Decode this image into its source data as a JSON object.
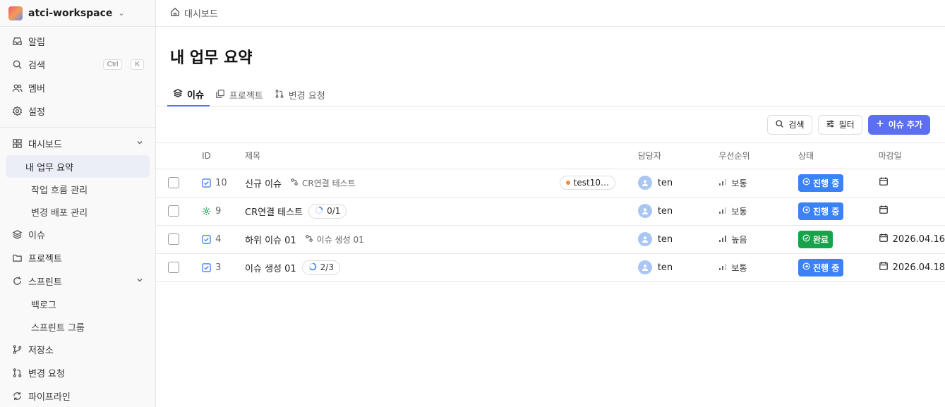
{
  "workspace": {
    "name": "atci-workspace"
  },
  "sidebar": {
    "top_items": [
      {
        "label": "알림",
        "icon": "inbox-icon"
      },
      {
        "label": "검색",
        "icon": "search-icon",
        "shortcut": [
          "Ctrl",
          "K"
        ]
      },
      {
        "label": "멤버",
        "icon": "members-icon"
      },
      {
        "label": "설정",
        "icon": "settings-icon"
      }
    ],
    "dashboard": {
      "label": "대시보드",
      "children": [
        "내 업무 요약",
        "작업 흐름 관리",
        "변경 배포 관리"
      ]
    },
    "issues": "이슈",
    "projects": "프로젝트",
    "sprint": {
      "label": "스프린트",
      "children": [
        "백로그",
        "스프린트 그룹"
      ]
    },
    "repository": "저장소",
    "change_request": "변경 요청",
    "pipeline": "파이프라인"
  },
  "breadcrumb": "대시보드",
  "page_title": "내 업무 요약",
  "tabs": [
    {
      "label": "이슈",
      "active": true
    },
    {
      "label": "프로젝트",
      "active": false
    },
    {
      "label": "변경 요청",
      "active": false
    }
  ],
  "toolbar": {
    "search": "검색",
    "filter": "필터",
    "add_issue": "이슈 추가"
  },
  "table": {
    "headers": {
      "id": "ID",
      "title": "제목",
      "assignee": "담당자",
      "priority": "우선순위",
      "status": "상태",
      "due": "마감일"
    },
    "rows": [
      {
        "id": "10",
        "type": "task",
        "title": "신규 이슈",
        "link": "CR연결 테스트",
        "progress": "",
        "tag": "test10…",
        "assignee": "ten",
        "priority": "보통",
        "status": "진행 중",
        "status_color": "#3b82f6",
        "due": ""
      },
      {
        "id": "9",
        "type": "epic",
        "title": "CR연결 테스트",
        "link": "",
        "progress": "0/1",
        "tag": "",
        "assignee": "ten",
        "priority": "보통",
        "status": "진행 중",
        "status_color": "#3b82f6",
        "due": ""
      },
      {
        "id": "4",
        "type": "task",
        "title": "하위 이슈 01",
        "link": "이슈 생성 01",
        "progress": "",
        "tag": "",
        "assignee": "ten",
        "priority": "높음",
        "status": "완료",
        "status_color": "#16a34a",
        "due": "2026.04.16"
      },
      {
        "id": "3",
        "type": "task",
        "title": "이슈 생성 01",
        "link": "",
        "progress": "2/3",
        "tag": "",
        "assignee": "ten",
        "priority": "보통",
        "status": "진행 중",
        "status_color": "#3b82f6",
        "due": "2026.04.18"
      }
    ]
  },
  "colors": {
    "accent": "#5b6ff0",
    "in_progress": "#3b82f6",
    "done": "#16a34a",
    "tag_dot": "#f08c3c"
  }
}
